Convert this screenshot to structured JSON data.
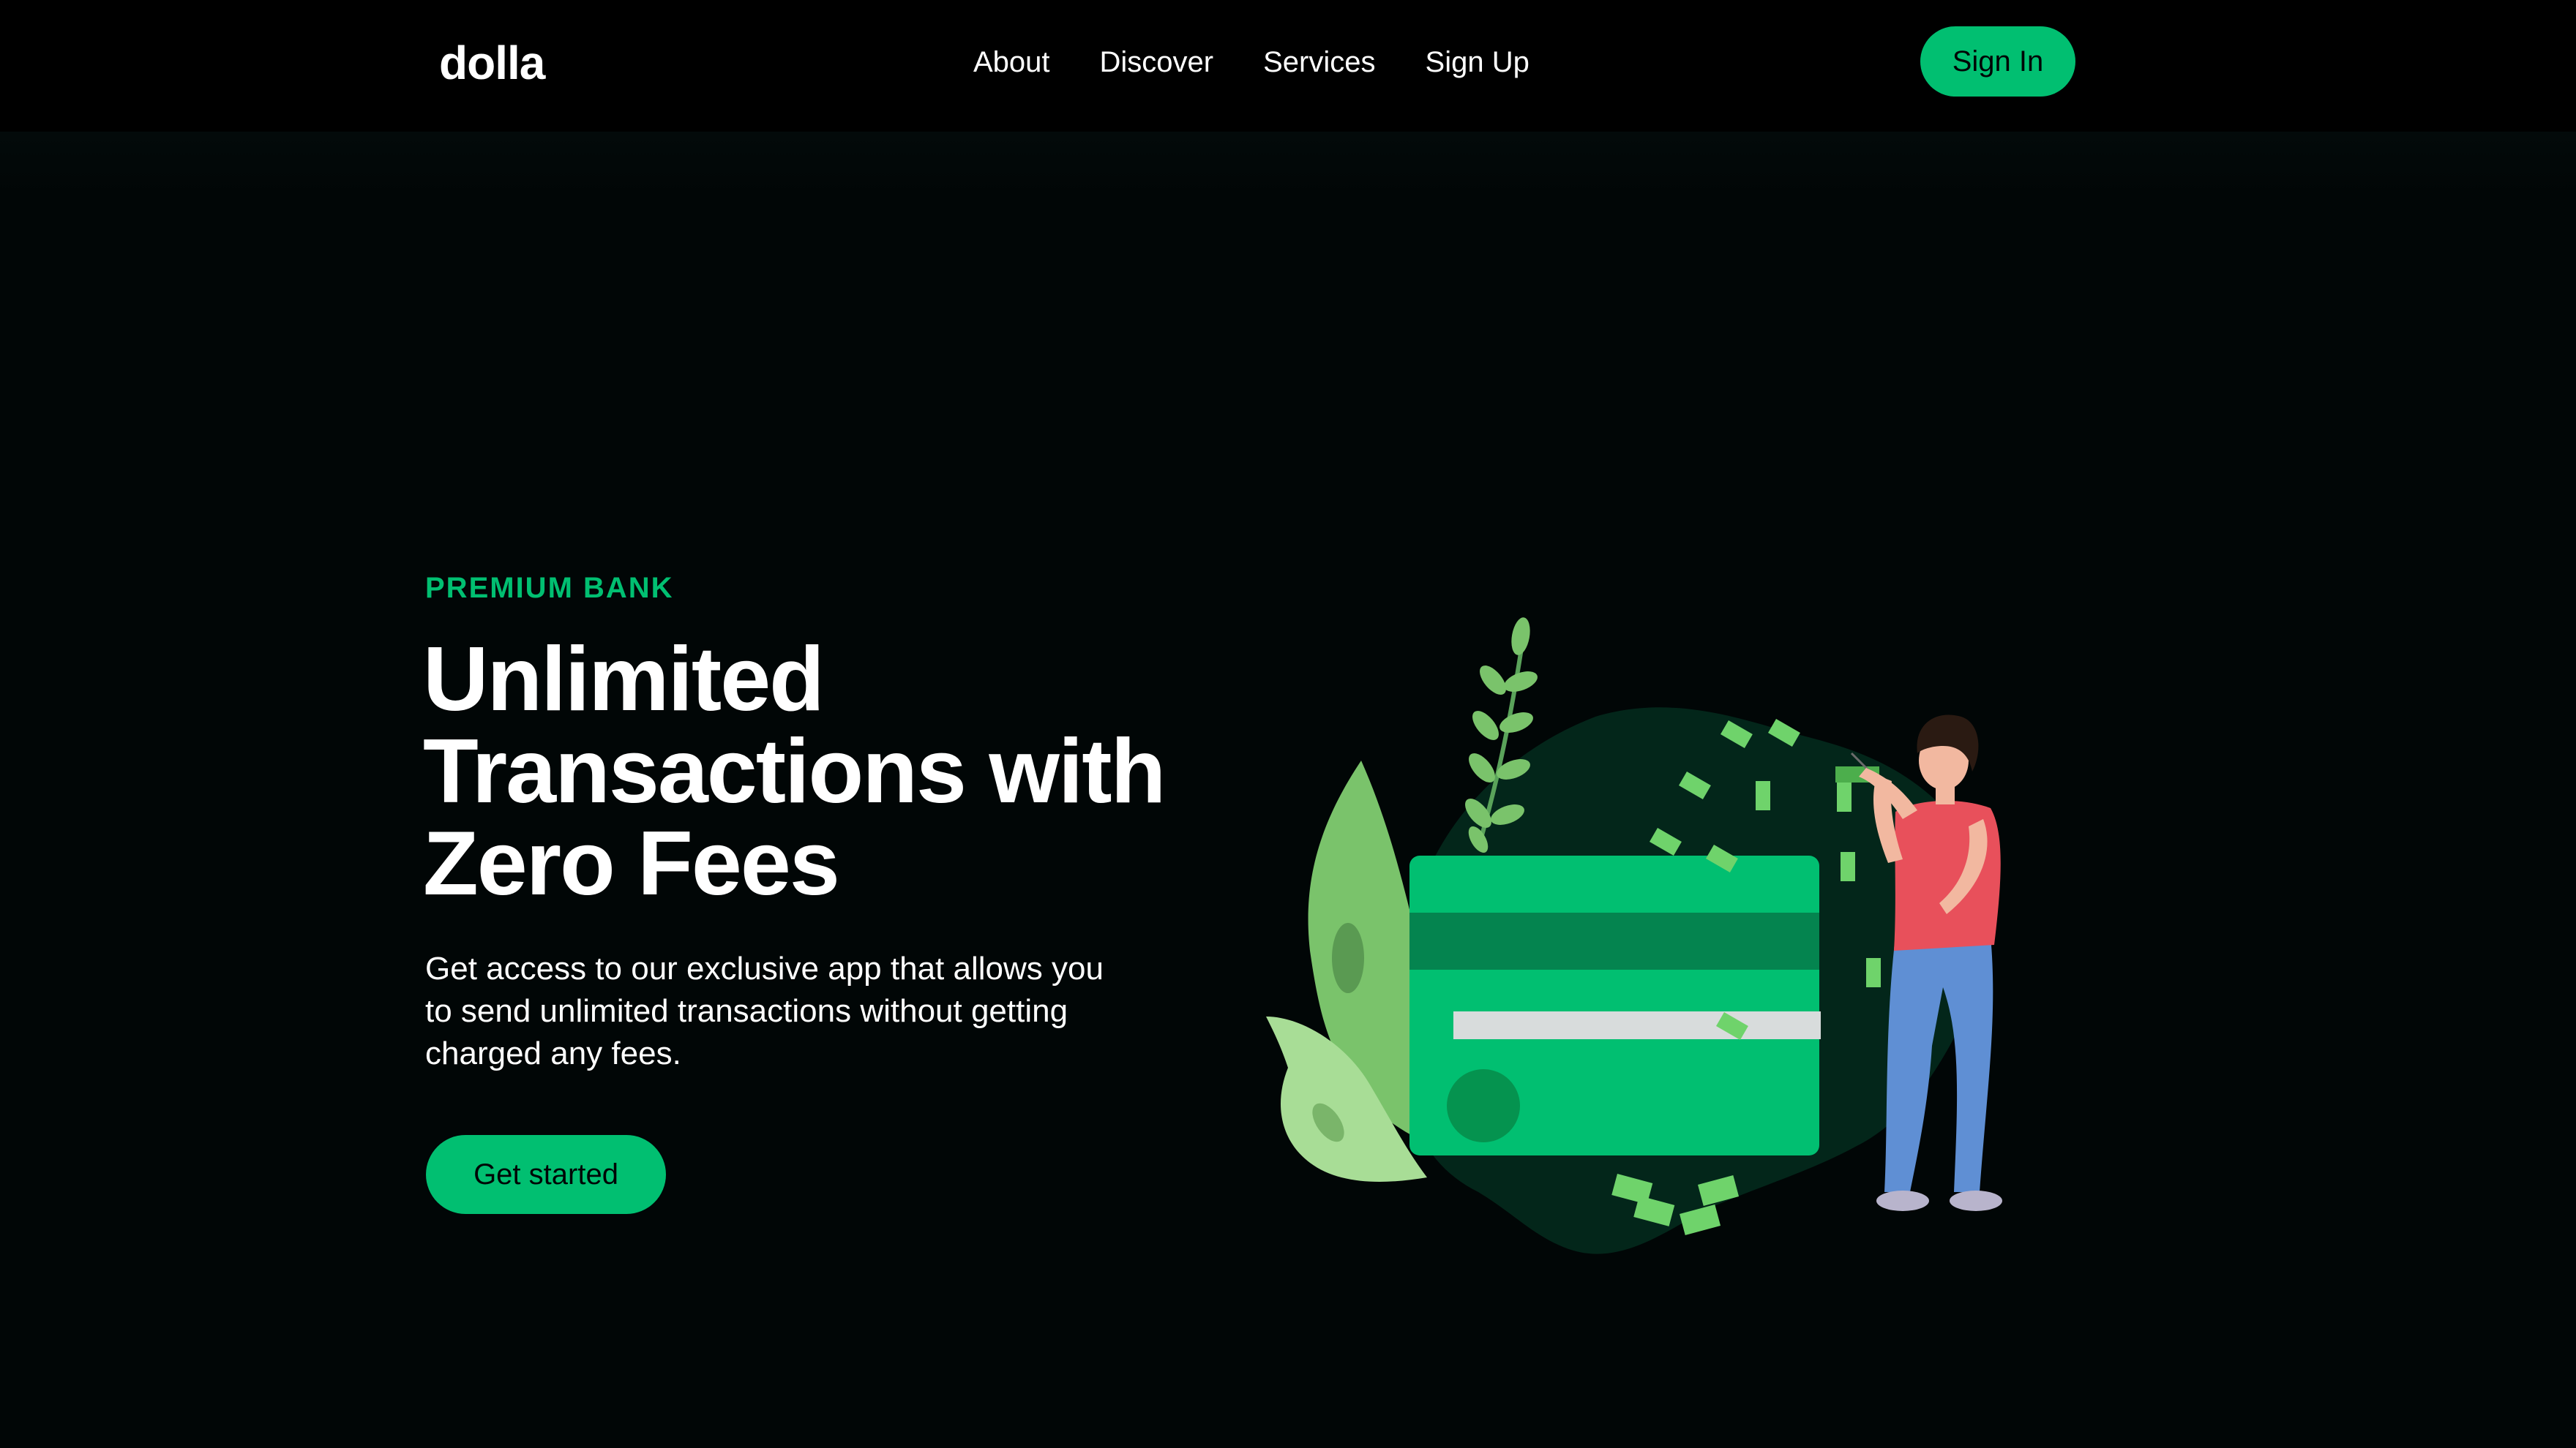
{
  "brand": {
    "logo_text": "dolla",
    "accent_color": "#01bf71",
    "background_color": "#010606"
  },
  "nav": {
    "items": [
      {
        "label": "About"
      },
      {
        "label": "Discover"
      },
      {
        "label": "Services"
      },
      {
        "label": "Sign Up"
      }
    ],
    "signin_label": "Sign In"
  },
  "hero": {
    "kicker": "PREMIUM BANK",
    "headline": "Unlimited Transactions with Zero Fees",
    "description": "Get access to our exclusive app that allows you to send unlimited transactions without getting charged any fees.",
    "cta_label": "Get started",
    "illustration_icon": "credit-card-person-illustration"
  }
}
